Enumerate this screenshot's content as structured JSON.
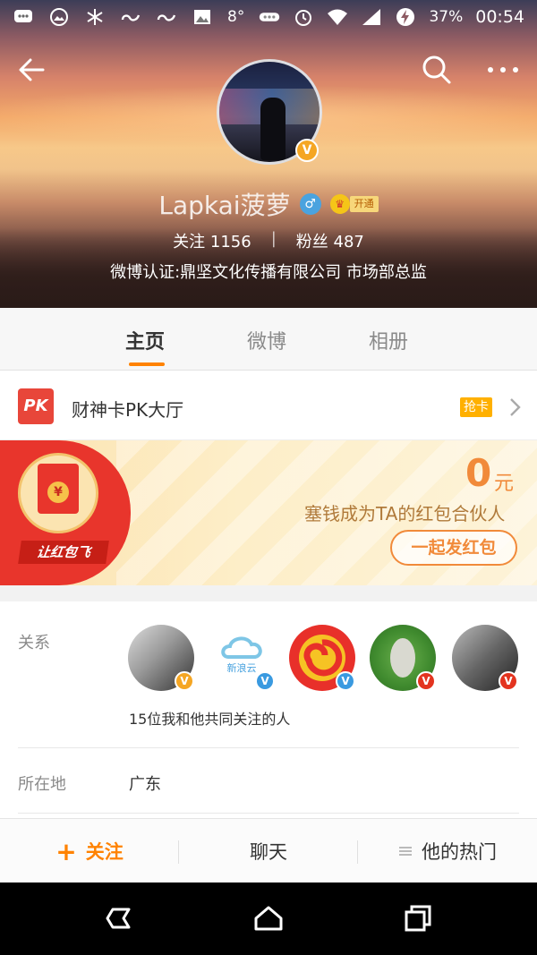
{
  "status_bar": {
    "temperature": "8°",
    "battery": "37%",
    "time": "00:54",
    "icons": [
      "chat-icon",
      "gallery-icon",
      "snowflake-icon",
      "cloud-link-icon",
      "cloud-link-icon",
      "image-icon",
      "dots-icon",
      "alarm-icon",
      "wifi-icon",
      "signal-icon",
      "battery-charging-icon"
    ]
  },
  "profile": {
    "name": "Lapkai菠萝",
    "vip_label": "开通",
    "avatar_badge": "V",
    "following_label": "关注",
    "following_count": "1156",
    "followers_label": "粉丝",
    "followers_count": "487",
    "separator": "|",
    "verification": "微博认证:鼎坚文化传播有限公司 市场部总监"
  },
  "tabs": [
    {
      "label": "主页",
      "active": true
    },
    {
      "label": "微博",
      "active": false
    },
    {
      "label": "相册",
      "active": false
    }
  ],
  "pk": {
    "logo": "PK",
    "title": "财神卡PK大厅",
    "badge": "抢卡"
  },
  "banner": {
    "slogan": "让红包飞",
    "amount": "0",
    "unit": "元",
    "description": "塞钱成为TA的红包合伙人",
    "button": "一起发红包",
    "envelope_symbol": "¥"
  },
  "relationship": {
    "label": "关系",
    "caption": "15位我和他共同关注的人",
    "avatar_badge": "V",
    "cloud_logo_text": "新浪云"
  },
  "location": {
    "label": "所在地",
    "value": "广东"
  },
  "actions": {
    "follow": "关注",
    "follow_icon": "+",
    "chat": "聊天",
    "hot": "他的热门"
  },
  "colors": {
    "accent": "#ff8200",
    "verified_gold": "#f5a623",
    "verified_blue": "#3a9ae0",
    "verified_red": "#e3341f",
    "pk_red": "#e8463a"
  }
}
